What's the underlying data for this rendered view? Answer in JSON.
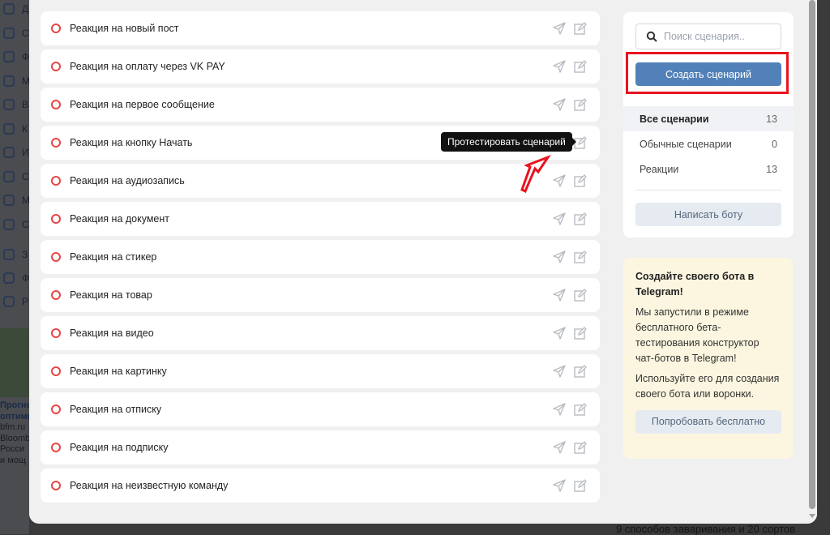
{
  "background": {
    "sidebar_letters": [
      "Д",
      "С",
      "Ф",
      "М",
      "В",
      "К",
      "И",
      "С",
      "М",
      "С",
      "З",
      "Ф",
      "Р"
    ],
    "news": [
      "Прогно",
      "оптими",
      "bfm.ru",
      "Bloomb",
      "Росси",
      "и мощ"
    ],
    "bottom_text": "9 способов заваривания и 20 сортов"
  },
  "scenarios": [
    "Реакция на новый пост",
    "Реакция на оплату через VK PAY",
    "Реакция на первое сообщение",
    "Реакция на кнопку Начать",
    "Реакция на аудиозапись",
    "Реакция на документ",
    "Реакция на стикер",
    "Реакция на товар",
    "Реакция на видео",
    "Реакция на картинку",
    "Реакция на отписку",
    "Реакция на подписку",
    "Реакция на неизвестную команду"
  ],
  "tooltip": "Протестировать сценарий",
  "sidebar": {
    "search_placeholder": "Поиск сценария..",
    "create_button": "Создать сценарий",
    "filters": [
      {
        "label": "Все сценарии",
        "count": "13"
      },
      {
        "label": "Обычные сценарии",
        "count": "0"
      },
      {
        "label": "Реакции",
        "count": "13"
      }
    ],
    "write_bot": "Написать боту"
  },
  "promo": {
    "title": "Создайте своего бота в Telegram!",
    "p1": "Мы запустили в режиме бесплатного бета-тестирования конструктор чат-ботов в Telegram!",
    "p2": "Используйте его для создания своего бота или воронки.",
    "button": "Попробовать бесплатно"
  },
  "colors": {
    "accent": "#5181b8",
    "highlight": "#e8141e",
    "status": "#e64646"
  }
}
